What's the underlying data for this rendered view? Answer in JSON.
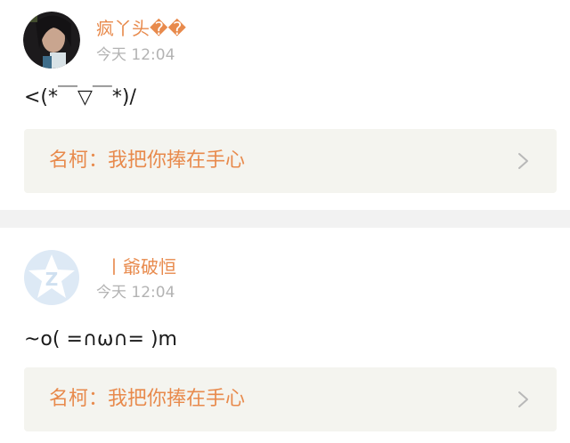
{
  "posts": [
    {
      "username": "疯丫头��",
      "time": "今天 12:04",
      "content": "<(*￣▽￣*)/",
      "quote": "名柯：我把你捧在手心"
    },
    {
      "username": "丨爺破恒",
      "time": "今天 12:04",
      "content": "~o( =∩ω∩= )m",
      "quote": "名柯：我把你捧在手心"
    }
  ],
  "colors": {
    "accent": "#e88a4c",
    "timestamp": "#b3b3b3",
    "card_bg": "#f4f4ef",
    "divider": "#f2f2f2"
  }
}
